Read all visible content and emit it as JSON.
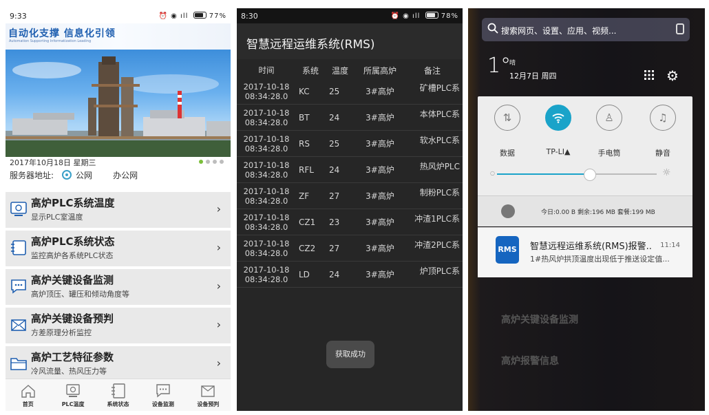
{
  "plc_home": {
    "status_bar": {
      "time": "9:33",
      "battery": "77%"
    },
    "slogan": {
      "main": "自动化支撑 信息化引领",
      "sub": "Automation Supporting Informatization Leading"
    },
    "date": "2017年10月18日 星期三",
    "server": {
      "label": "服务器地址:",
      "options": [
        {
          "label": "公网",
          "selected": true
        },
        {
          "label": "办公网",
          "selected": false
        }
      ]
    },
    "menu": [
      {
        "title": "高炉PLC系统温度",
        "sub": "显示PLC室温度",
        "icon": "monitor-icon"
      },
      {
        "title": "高炉PLC系统状态",
        "sub": "监控高炉各系统PLC状态",
        "icon": "document-icon"
      },
      {
        "title": "高炉关键设备监测",
        "sub": "高炉顶压、罐压和倾动角度等",
        "icon": "chat-icon"
      },
      {
        "title": "高炉关键设备预判",
        "sub": "方差原理分析监控",
        "icon": "envelope-icon"
      },
      {
        "title": "高炉工艺特征参数",
        "sub": "冷风流量、热风压力等",
        "icon": "folder-icon"
      }
    ],
    "tabs": [
      {
        "label": "首页",
        "icon": "home-icon"
      },
      {
        "label": "PLC温度",
        "icon": "monitor-icon"
      },
      {
        "label": "系统状态",
        "icon": "document-icon"
      },
      {
        "label": "设备监测",
        "icon": "chat-icon"
      },
      {
        "label": "设备预判",
        "icon": "envelope-icon"
      }
    ],
    "colors": {
      "accent": "#1f5fb0",
      "radio": "#3aa0c8",
      "dot_active": "#7bbe3a",
      "menu_bg": "#e9e9e9"
    }
  },
  "rms_table": {
    "status_bar": {
      "time": "8:30",
      "battery": "78%"
    },
    "title": "智慧远程运维系统(RMS)",
    "headers": [
      "时间",
      "系统",
      "温度",
      "所属高炉",
      "备注"
    ],
    "rows": [
      {
        "date": "2017-10-18",
        "time": "08:34:28.0",
        "system": "KC",
        "temp": "25",
        "furnace": "3#高炉",
        "note": "矿槽PLC系"
      },
      {
        "date": "2017-10-18",
        "time": "08:34:28.0",
        "system": "BT",
        "temp": "24",
        "furnace": "3#高炉",
        "note": "本体PLC系"
      },
      {
        "date": "2017-10-18",
        "time": "08:34:28.0",
        "system": "RS",
        "temp": "25",
        "furnace": "3#高炉",
        "note": "软水PLC系"
      },
      {
        "date": "2017-10-18",
        "time": "08:34:28.0",
        "system": "RFL",
        "temp": "24",
        "furnace": "3#高炉",
        "note": "热风炉PLC"
      },
      {
        "date": "2017-10-18",
        "time": "08:34:28.0",
        "system": "ZF",
        "temp": "27",
        "furnace": "3#高炉",
        "note": "制粉PLC系"
      },
      {
        "date": "2017-10-18",
        "time": "08:34:28.0",
        "system": "CZ1",
        "temp": "23",
        "furnace": "3#高炉",
        "note": "冲渣1PLC系"
      },
      {
        "date": "2017-10-18",
        "time": "08:34:28.0",
        "system": "CZ2",
        "temp": "27",
        "furnace": "3#高炉",
        "note": "冲渣2PLC系"
      },
      {
        "date": "2017-10-18",
        "time": "08:34:28.0",
        "system": "LD",
        "temp": "24",
        "furnace": "3#高炉",
        "note": "炉顶PLC系"
      }
    ],
    "toast": "获取成功"
  },
  "notification_shade": {
    "search_placeholder": "搜索网页、设置、应用、视频...",
    "weather": {
      "temp": "1°",
      "condition": "晴",
      "date": "12月7日 周四"
    },
    "quick_settings": [
      {
        "label": "数据",
        "icon": "data-arrows-icon",
        "on": false
      },
      {
        "label": "TP-LI",
        "icon": "wifi-icon",
        "on": true
      },
      {
        "label": "手电筒",
        "icon": "flashlight-icon",
        "on": false
      },
      {
        "label": "静音",
        "icon": "bell-icon",
        "on": false
      }
    ],
    "brightness_level": 0.57,
    "data_usage": "今日:0.00 B  剩余:196 MB  套餐:199 MB",
    "notification": {
      "app": "RMS",
      "title": "智慧远程运维系统(RMS)报警..",
      "time": "11:14",
      "body": "1#热风炉拱顶温度出现低于推送设定值..."
    },
    "background_menu": [
      "高炉关键设备监测",
      "高炉报警信息"
    ],
    "colors": {
      "wifi_on": "#1aa3c9",
      "rms_logo": "#1565c0"
    }
  }
}
